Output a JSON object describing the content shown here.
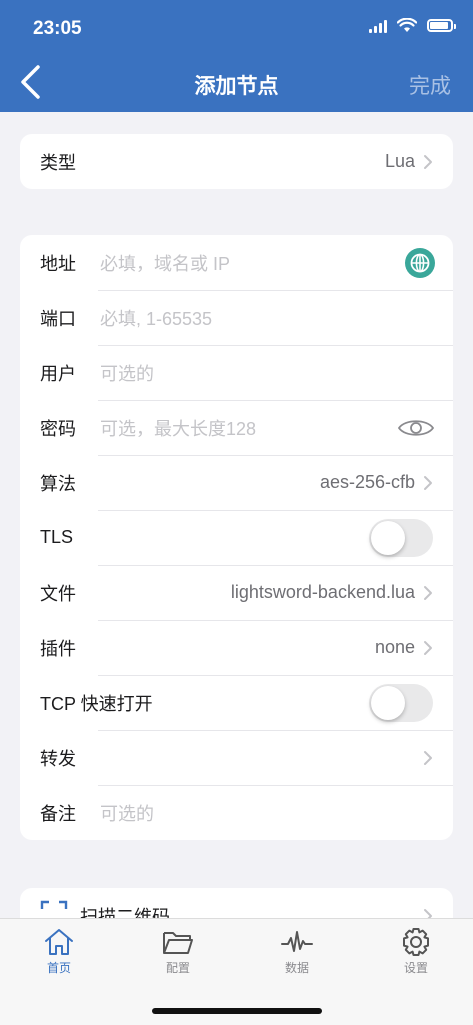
{
  "status": {
    "time": "23:05"
  },
  "nav": {
    "title": "添加节点",
    "done": "完成"
  },
  "type_card": {
    "label": "类型",
    "value": "Lua"
  },
  "form": {
    "address": {
      "label": "地址",
      "placeholder": "必填，域名或 IP"
    },
    "port": {
      "label": "端口",
      "placeholder": "必填, 1-65535"
    },
    "user": {
      "label": "用户",
      "placeholder": "可选的"
    },
    "password": {
      "label": "密码",
      "placeholder": "可选，最大长度128"
    },
    "algorithm": {
      "label": "算法",
      "value": "aes-256-cfb"
    },
    "tls": {
      "label": "TLS",
      "on": false
    },
    "file": {
      "label": "文件",
      "value": "lightsword-backend.lua"
    },
    "plugin": {
      "label": "插件",
      "value": "none"
    },
    "tcp_fast_open": {
      "label": "TCP 快速打开",
      "on": false
    },
    "forward": {
      "label": "转发"
    },
    "note": {
      "label": "备注",
      "placeholder": "可选的"
    }
  },
  "scan": {
    "label": "扫描二维码"
  },
  "tabbar": {
    "items": [
      {
        "label": "首页",
        "icon": "house-icon",
        "active": true
      },
      {
        "label": "配置",
        "icon": "folder-icon",
        "active": false
      },
      {
        "label": "数据",
        "icon": "waveform-icon",
        "active": false
      },
      {
        "label": "设置",
        "icon": "gear-icon",
        "active": false
      }
    ]
  },
  "colors": {
    "accent": "#3a72c0",
    "globe": "#3aa79a"
  }
}
